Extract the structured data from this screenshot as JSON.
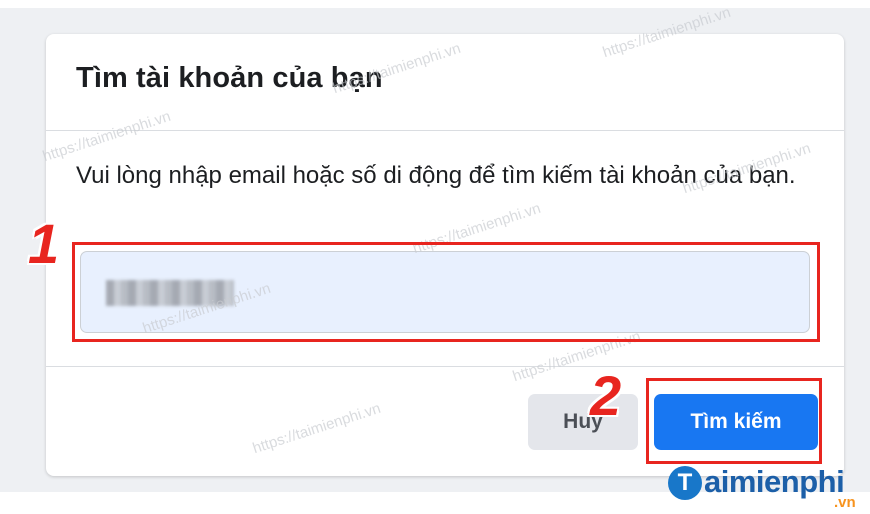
{
  "dialog": {
    "title": "Tìm tài khoản của bạn",
    "description": "Vui lòng nhập email hoặc số di động để tìm kiếm tài khoản của bạn.",
    "input_value": ""
  },
  "buttons": {
    "cancel_label": "Huỷ",
    "search_label": "Tìm kiếm"
  },
  "annotations": {
    "step1": "1",
    "step2": "2"
  },
  "watermark_text": "https://taimienphi.vn",
  "logo": {
    "initial": "T",
    "text": "aimienphi",
    "suffix": ".vn"
  },
  "colors": {
    "primary_button": "#1877f2",
    "highlight": "#e8251f",
    "input_bg": "#e8f0fe"
  }
}
